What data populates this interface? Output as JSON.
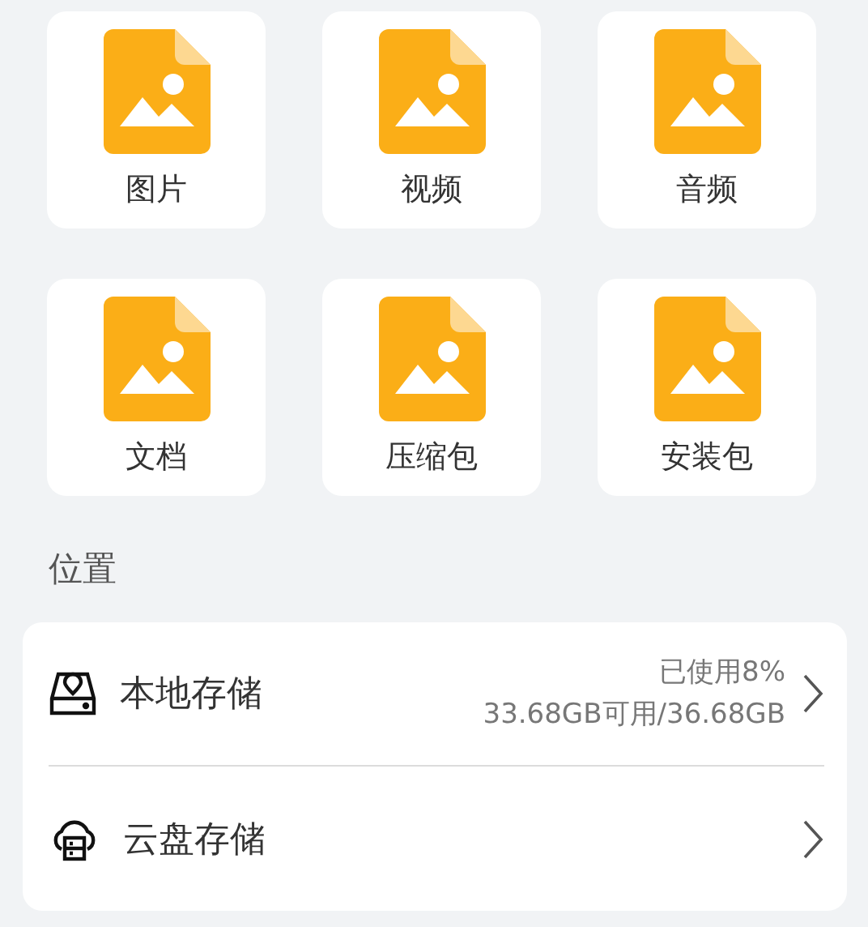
{
  "categories": [
    {
      "label": "图片"
    },
    {
      "label": "视频"
    },
    {
      "label": "音频"
    },
    {
      "label": "文档"
    },
    {
      "label": "压缩包"
    },
    {
      "label": "安装包"
    }
  ],
  "section_title": "位置",
  "locations": [
    {
      "kind": "local",
      "name": "本地存储",
      "usage": "已使用8%",
      "capacity": "33.68GB可用/36.68GB"
    },
    {
      "kind": "cloud",
      "name": "云盘存储"
    }
  ]
}
